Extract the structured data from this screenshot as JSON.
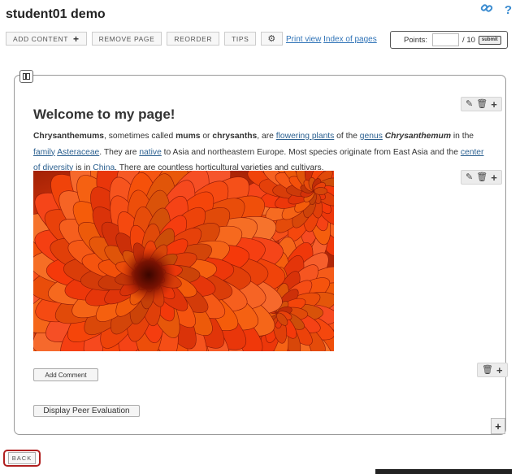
{
  "page": {
    "title": "student01 demo"
  },
  "top_icons": {
    "link_icon": "link-icon",
    "help_icon": "help-icon"
  },
  "toolbar": {
    "add_content": "ADD CONTENT",
    "remove_page": "REMOVE PAGE",
    "reorder": "REORDER",
    "tips": "TIPS"
  },
  "links": {
    "print_view": "Print view",
    "index_of_pages": "Index of pages"
  },
  "points": {
    "label": "Points:",
    "value": "",
    "max": "/ 10",
    "submit": "submit"
  },
  "content": {
    "heading": "Welcome to my page!",
    "paragraph": [
      {
        "t": "Chrysanthemums",
        "s": "b"
      },
      {
        "t": ", sometimes called "
      },
      {
        "t": "mums",
        "s": "b"
      },
      {
        "t": " or "
      },
      {
        "t": "chrysanths",
        "s": "b"
      },
      {
        "t": ", are "
      },
      {
        "t": "flowering plants",
        "s": "a"
      },
      {
        "t": " of the "
      },
      {
        "t": "genus",
        "s": "a"
      },
      {
        "t": " "
      },
      {
        "t": "Chrysanthemum",
        "s": "bi"
      },
      {
        "t": " in the "
      },
      {
        "t": "family",
        "s": "a"
      },
      {
        "t": " "
      },
      {
        "t": "Asteraceae",
        "s": "a"
      },
      {
        "t": ". They are "
      },
      {
        "t": "native",
        "s": "a"
      },
      {
        "t": " to Asia and northeastern Europe. Most species originate from East Asia and the "
      },
      {
        "t": "center of diversity",
        "s": "a"
      },
      {
        "t": " is in "
      },
      {
        "t": "China",
        "s": "a"
      },
      {
        "t": ". There are countless horticultural varieties and cultivars."
      }
    ]
  },
  "buttons": {
    "add_comment": "Add Comment",
    "display_peer_evaluation": "Display Peer Evaluation",
    "back": "BACK"
  },
  "colors": {
    "link": "#2a5f8f",
    "back_border": "#b02020",
    "flower_base": "#b82a08"
  }
}
